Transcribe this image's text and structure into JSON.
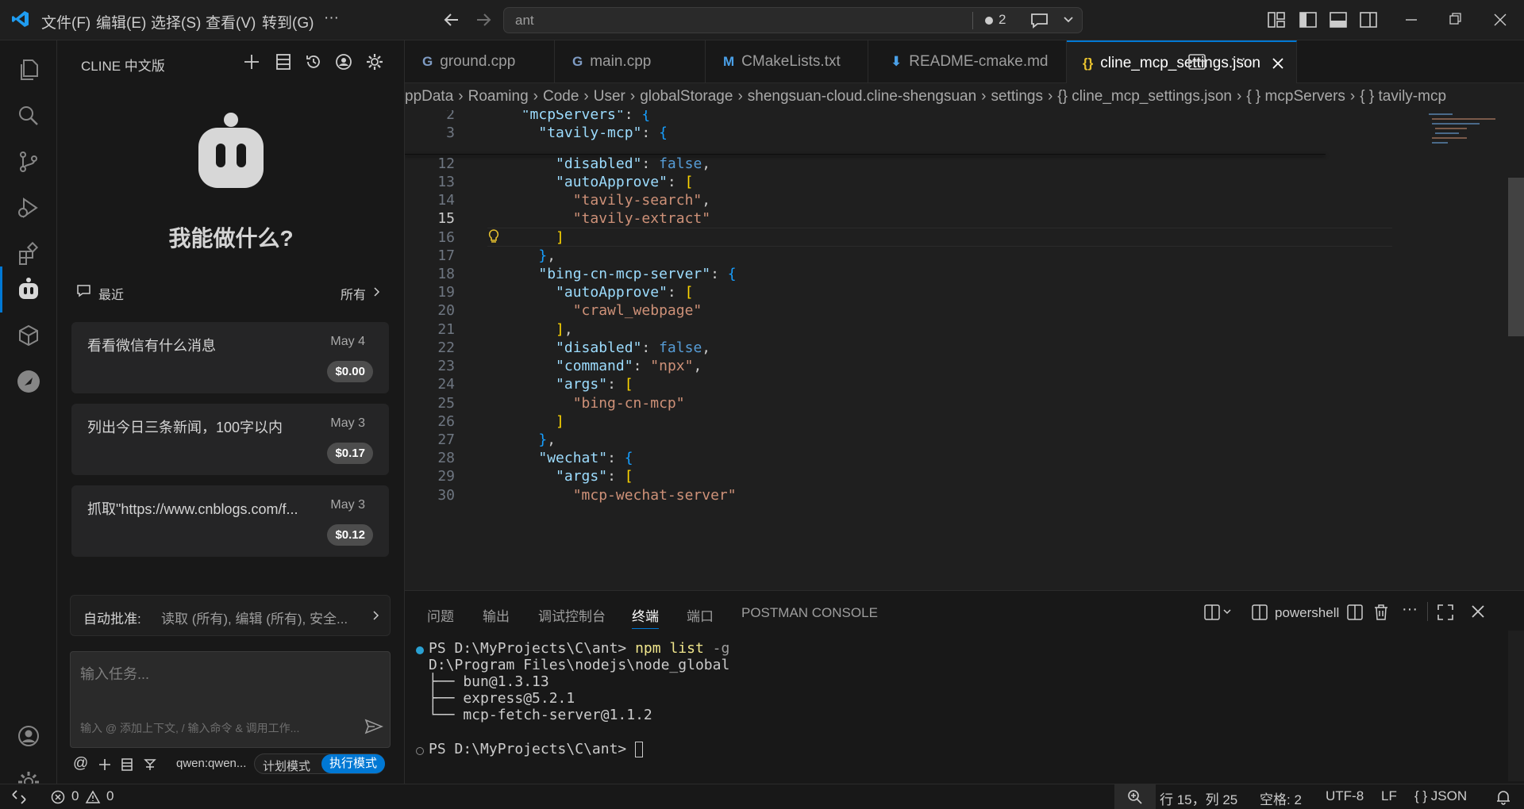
{
  "titlebar": {
    "menus": [
      "文件(F)",
      "编辑(E)",
      "选择(S)",
      "查看(V)",
      "转到(G)"
    ],
    "more": "···",
    "search": "ant",
    "badge": "2"
  },
  "sidebar": {
    "title": "CLINE 中文版",
    "heading": "我能做什么?",
    "recent_label": "最近",
    "all_label": "所有",
    "history": [
      {
        "title": "看看微信有什么消息",
        "date": "May 4",
        "cost": "$0.00"
      },
      {
        "title": "列出今日三条新闻，100字以内",
        "date": "May 3",
        "cost": "$0.17"
      },
      {
        "title": "抓取\"https://www.cnblogs.com/f...",
        "date": "May 3",
        "cost": "$0.12"
      }
    ],
    "auto_approve_label": "自动批准:",
    "auto_approve_value": "读取 (所有), 编辑 (所有), 安全...",
    "input_placeholder": "输入任务...",
    "input_hint": "输入 @ 添加上下文, / 输入命令 & 调用工作...",
    "model": "qwen:qwen...",
    "plan_mode": "计划模式",
    "act_mode": "执行模式"
  },
  "tabs": [
    {
      "icon": "G",
      "label": "ground.cpp"
    },
    {
      "icon": "G",
      "label": "main.cpp"
    },
    {
      "icon": "M",
      "label": "CMakeLists.txt"
    },
    {
      "icon": "⬇",
      "label": "README-cmake.md"
    },
    {
      "icon": "{}",
      "label": "cline_mcp_settings.json"
    }
  ],
  "breadcrumb": [
    "ppData",
    "Roaming",
    "Code",
    "User",
    "globalStorage",
    "shengsuan-cloud.cline-shengsuan",
    "settings",
    "{} cline_mcp_settings.json",
    "{ } mcpServers",
    "{ } tavily-mcp"
  ],
  "code_lines": [
    {
      "n": "2",
      "t": "  \"mcpServers\": {"
    },
    {
      "n": "3",
      "t": "    \"tavily-mcp\": {"
    },
    {
      "n": "12",
      "t": "      \"disabled\": false,"
    },
    {
      "n": "13",
      "t": "      \"autoApprove\": ["
    },
    {
      "n": "14",
      "t": "        \"tavily-search\","
    },
    {
      "n": "15",
      "t": "        \"tavily-extract\""
    },
    {
      "n": "16",
      "t": "      ]"
    },
    {
      "n": "17",
      "t": "    },"
    },
    {
      "n": "18",
      "t": "    \"bing-cn-mcp-server\": {"
    },
    {
      "n": "19",
      "t": "      \"autoApprove\": ["
    },
    {
      "n": "20",
      "t": "        \"crawl_webpage\""
    },
    {
      "n": "21",
      "t": "      ],"
    },
    {
      "n": "22",
      "t": "      \"disabled\": false,"
    },
    {
      "n": "23",
      "t": "      \"command\": \"npx\","
    },
    {
      "n": "24",
      "t": "      \"args\": ["
    },
    {
      "n": "25",
      "t": "        \"bing-cn-mcp\""
    },
    {
      "n": "26",
      "t": "      ]"
    },
    {
      "n": "27",
      "t": "    },"
    },
    {
      "n": "28",
      "t": "    \"wechat\": {"
    },
    {
      "n": "29",
      "t": "      \"args\": ["
    },
    {
      "n": "30",
      "t": "        \"mcp-wechat-server\""
    }
  ],
  "panel": {
    "tabs": [
      "问题",
      "输出",
      "调试控制台",
      "终端",
      "端口",
      "POSTMAN CONSOLE"
    ],
    "active_tab": "终端",
    "shell": "powershell",
    "terminal": [
      {
        "prompt": "PS D:\\MyProjects\\C\\ant> ",
        "cmd": "npm list",
        "arg": " -g"
      },
      {
        "text": "D:\\Program Files\\nodejs\\node_global"
      },
      {
        "text": "├── bun@1.3.13"
      },
      {
        "text": "├── express@5.2.1"
      },
      {
        "text": "└── mcp-fetch-server@1.1.2"
      },
      {
        "text": ""
      },
      {
        "prompt": "PS D:\\MyProjects\\C\\ant> "
      }
    ]
  },
  "status": {
    "errors": "0",
    "warnings": "0",
    "position": "行 15，列 25",
    "spaces": "空格: 2",
    "encoding": "UTF-8",
    "eol": "LF",
    "lang": "{ } JSON"
  },
  "colors": {
    "accent": "#0078d4",
    "key": "#9cdcfe",
    "string": "#ce9178",
    "keyword": "#569cd6"
  }
}
